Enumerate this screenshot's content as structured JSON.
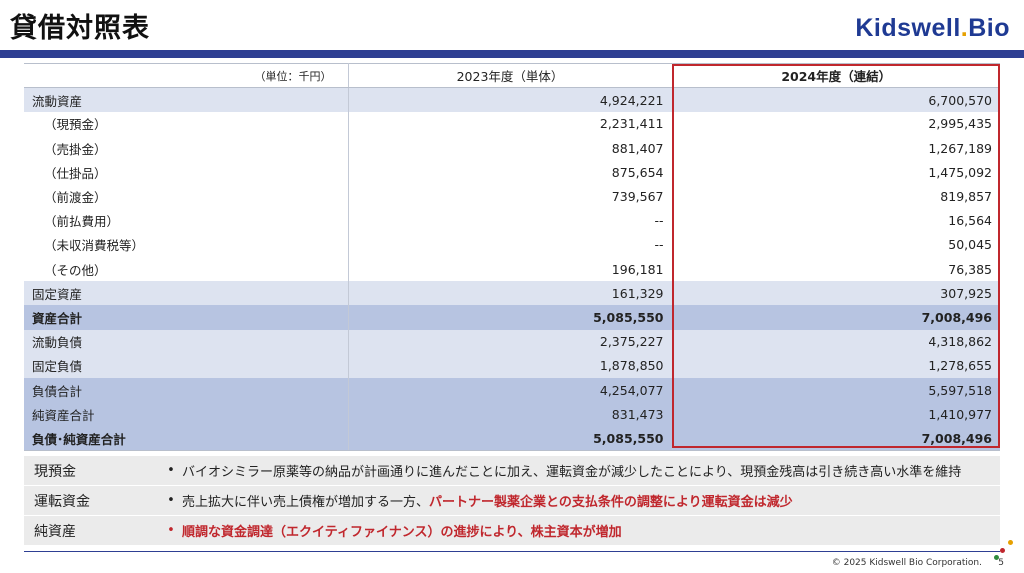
{
  "title": "貸借対照表",
  "logo": {
    "main": "Kidswell",
    "dot": ".",
    "suffix": "Bio"
  },
  "table": {
    "unit_label": "（単位：千円）",
    "col_2023": "2023年度（単体）",
    "col_2024": "2024年度（連結）",
    "rows": [
      {
        "label": "流動資産",
        "v2023": "4,924,221",
        "v2024": "6,700,570"
      },
      {
        "label": "（現預金）",
        "v2023": "2,231,411",
        "v2024": "2,995,435"
      },
      {
        "label": "（売掛金）",
        "v2023": "881,407",
        "v2024": "1,267,189"
      },
      {
        "label": "（仕掛品）",
        "v2023": "875,654",
        "v2024": "1,475,092"
      },
      {
        "label": "（前渡金）",
        "v2023": "739,567",
        "v2024": "819,857"
      },
      {
        "label": "（前払費用）",
        "v2023": "--",
        "v2024": "16,564"
      },
      {
        "label": "（未収消費税等）",
        "v2023": "--",
        "v2024": "50,045"
      },
      {
        "label": "（その他）",
        "v2023": "196,181",
        "v2024": "76,385"
      },
      {
        "label": "固定資産",
        "v2023": "161,329",
        "v2024": "307,925"
      },
      {
        "label": "資産合計",
        "v2023": "5,085,550",
        "v2024": "7,008,496"
      },
      {
        "label": "流動負債",
        "v2023": "2,375,227",
        "v2024": "4,318,862"
      },
      {
        "label": "固定負債",
        "v2023": "1,878,850",
        "v2024": "1,278,655"
      },
      {
        "label": "負債合計",
        "v2023": "4,254,077",
        "v2024": "5,597,518"
      },
      {
        "label": "純資産合計",
        "v2023": "831,473",
        "v2024": "1,410,977"
      },
      {
        "label": "負債･純資産合計",
        "v2023": "5,085,550",
        "v2024": "7,008,496"
      }
    ]
  },
  "notes": [
    {
      "label": "現預金",
      "bullet": "•",
      "text": "バイオシミラー原薬等の納品が計画通りに進んだことに加え、運転資金が減少したことにより、現預金残高は引き続き高い水準を維持",
      "highlight": ""
    },
    {
      "label": "運転資金",
      "bullet": "•",
      "text": "売上拡大に伴い売上債権が増加する一方、",
      "highlight": "パートナー製薬企業との支払条件の調整により運転資金は減少"
    },
    {
      "label": "純資産",
      "bullet": "•",
      "text": "順調な資金調達（エクイティファイナンス）の進捗により、株主資本が増加",
      "highlight": ""
    }
  ],
  "footer": {
    "copyright": "© 2025 Kidswell Bio Corporation.",
    "page_number": "5"
  },
  "colors": {
    "accent_blue": "#2e3f93",
    "highlight_red": "#c0272d",
    "logo_blue": "#1f3a93"
  }
}
